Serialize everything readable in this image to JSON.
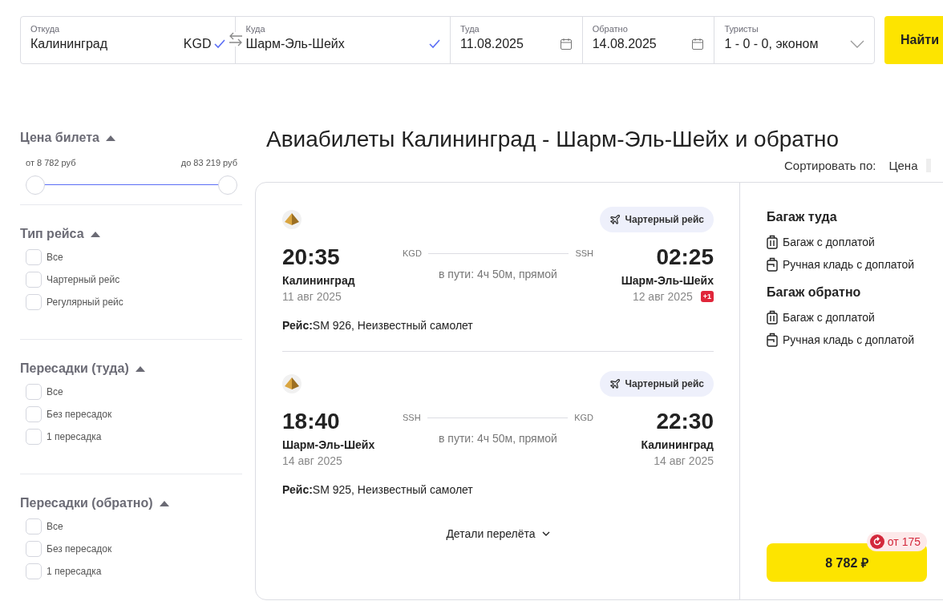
{
  "search": {
    "fields": [
      {
        "label": "Откуда",
        "value": "Калининград",
        "code": "KGD",
        "kind": "place"
      },
      {
        "label": "Куда",
        "value": "Шарм-Эль-Шейх",
        "kind": "place"
      },
      {
        "label": "Туда",
        "value": "11.08.2025",
        "kind": "date"
      },
      {
        "label": "Обратно",
        "value": "14.08.2025",
        "kind": "date"
      },
      {
        "label": "Туристы",
        "value": "1 - 0 - 0, эконом",
        "kind": "select"
      }
    ],
    "button": "Найти"
  },
  "filters": [
    {
      "kind": "range",
      "title": "Цена билета",
      "expanded": true,
      "from": "от 8 782 руб",
      "to": "до 83 219 руб",
      "thumbs": [
        {
          "level": 0
        },
        {
          "level": 1
        }
      ]
    },
    {
      "kind": "checks",
      "title": "Тип рейса",
      "expanded": true,
      "options": [
        {
          "label": "Все",
          "checked": false
        },
        {
          "label": "Чартерный рейс",
          "checked": false
        },
        {
          "label": "Регулярный рейс",
          "checked": false
        }
      ]
    },
    {
      "kind": "checks",
      "title": "Пересадки (туда)",
      "expanded": true,
      "options": [
        {
          "label": "Все",
          "checked": false
        },
        {
          "label": "Без пересадок",
          "checked": false
        },
        {
          "label": "1 пересадка",
          "checked": false
        }
      ]
    },
    {
      "kind": "checks",
      "title": "Пересадки (обратно)",
      "expanded": true,
      "options": [
        {
          "label": "Все",
          "checked": false
        },
        {
          "label": "Без пересадок",
          "checked": false
        },
        {
          "label": "1 пересадка",
          "checked": false
        }
      ]
    }
  ],
  "title": "Авиабилеты Калининград - Шарм-Эль-Шейх и обратно",
  "sort": {
    "label": "Сортировать по:",
    "value": "Цена"
  },
  "offer": {
    "legs": [
      {
        "badge": "Чартерный рейс",
        "dep_time": "20:35",
        "dep_city": "Калининград",
        "dep_date": "11 авг 2025",
        "from_code": "KGD",
        "to_code": "SSH",
        "duration": "в пути: 4ч 50м, прямой",
        "arr_time": "02:25",
        "arr_city": "Шарм-Эль-Шейх",
        "arr_date": "12 авг 2025",
        "day_shift": "+1",
        "info": "**Рейс:**SM 926, Неизвестный самолет"
      },
      {
        "badge": "Чартерный рейс",
        "dep_time": "18:40",
        "dep_city": "Шарм-Эль-Шейх",
        "dep_date": "14 авг 2025",
        "from_code": "SSH",
        "to_code": "KGD",
        "duration": "в пути: 4ч 50м, прямой",
        "arr_time": "22:30",
        "arr_city": "Калининград",
        "arr_date": "14 авг 2025",
        "info": "**Рейс:**SM 925, Неизвестный самолет"
      }
    ],
    "details": "Детали перелёта",
    "baggage": [
      {
        "title": "Багаж туда",
        "items": [
          {
            "kind": "suitcase",
            "label": "Багаж с доплатой"
          },
          {
            "kind": "bag",
            "label": "Ручная кладь с доплатой"
          }
        ]
      },
      {
        "title": "Багаж обратно",
        "items": [
          {
            "kind": "suitcase",
            "label": "Багаж с доплатой"
          },
          {
            "kind": "bag",
            "label": "Ручная кладь с доплатой"
          }
        ]
      }
    ],
    "price": "8 782 ₽",
    "cashback": "от 175"
  }
}
